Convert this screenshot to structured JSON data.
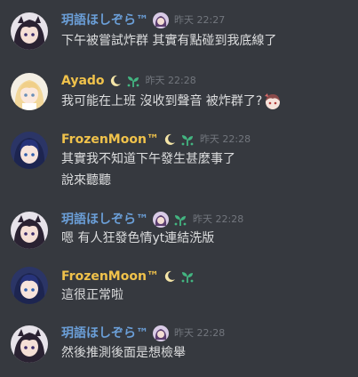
{
  "colors": {
    "background": "#36393f",
    "message_text": "#dcddde",
    "timestamp": "#72767d",
    "name_blue": "#6b9fd8",
    "name_gold": "#f0c24b",
    "sprout_green": "#43b581"
  },
  "messages": [
    {
      "author": "玥語ほしぞら™",
      "timestamp": "昨天 22:27",
      "lines": [
        "下午被嘗試炸群 其實有點碰到我底線了"
      ],
      "badges": [
        "anime-avatar-badge-icon"
      ]
    },
    {
      "author": "Ayado",
      "timestamp": "昨天 22:28",
      "lines": [
        "我可能在上班 沒收到聲音 被炸群了?"
      ],
      "badges": [
        "crescent-moon-icon",
        "sprout-icon"
      ],
      "inline_emoji": "anime-face-emoji-icon"
    },
    {
      "author": "FrozenMoon™",
      "timestamp": "昨天 22:28",
      "lines": [
        "其實我不知道下午發生甚麼事了",
        "說來聽聽"
      ],
      "badges": [
        "crescent-moon-icon",
        "sprout-icon"
      ]
    },
    {
      "author": "玥語ほしぞら™",
      "timestamp": "昨天 22:28",
      "lines": [
        "嗯 有人狂發色情yt連結洗版"
      ],
      "badges": [
        "anime-avatar-badge-icon",
        "sprout-icon"
      ]
    },
    {
      "author": "FrozenMoon™",
      "timestamp": "昨天 22:28",
      "lines": [
        "這很正常啦"
      ],
      "badges": [
        "crescent-moon-icon",
        "sprout-icon"
      ]
    },
    {
      "author": "玥語ほしぞら™",
      "timestamp": "昨天 22:28",
      "lines": [
        "然後推測後面是想檢舉"
      ],
      "badges": [
        "anime-avatar-badge-icon"
      ]
    }
  ]
}
